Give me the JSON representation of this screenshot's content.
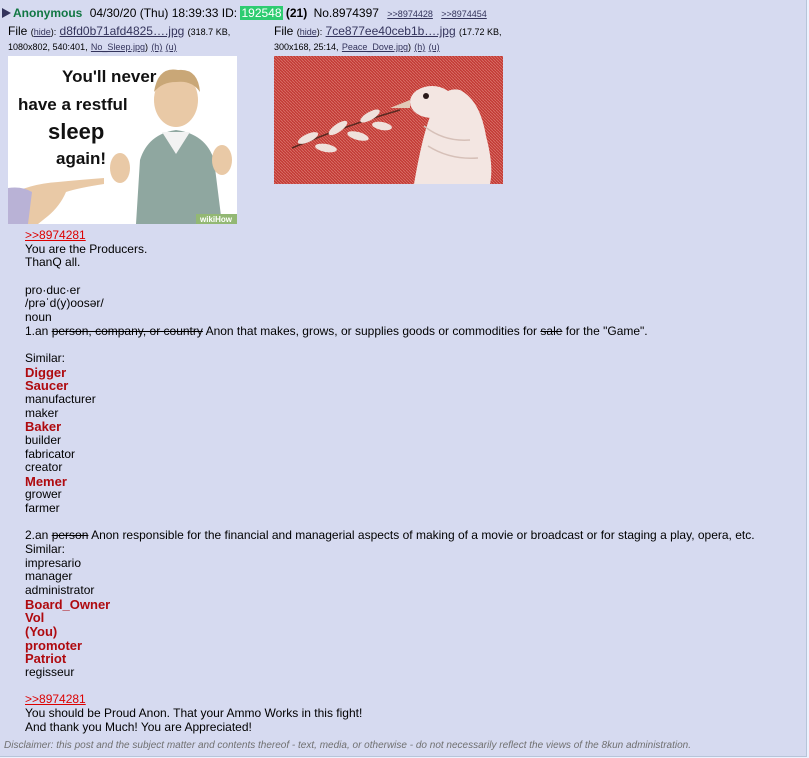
{
  "post": {
    "name": "Anonymous",
    "date": "04/30/20 (Thu) 18:39:33",
    "id_label": "ID:",
    "id": "192548",
    "id_count": "(21)",
    "no": "No.8974397",
    "backlinks": [
      ">>8974428",
      ">>8974454"
    ]
  },
  "files": [
    {
      "file_label": "File",
      "hide": "hide",
      "name": "d8fd0b71afd4825….jpg",
      "size_a": "(318.7 KB,",
      "size_b": "1080x802, 540:401,",
      "orig": "No_Sleep.jpg",
      "h": "(h)",
      "u": "(u)",
      "caption": "You'll never have a restful sleep again!",
      "watermark": "wikiHow"
    },
    {
      "file_label": "File",
      "hide": "hide",
      "name": "7ce877ee40ceb1b….jpg",
      "size_a": "(17.72 KB,",
      "size_b": "300x168, 25:14,",
      "orig": "Peace_Dove.jpg",
      "h": "(h)",
      "u": "(u)"
    }
  ],
  "body": {
    "quote1": ">>8974281",
    "l1": "You are the Producers.",
    "l2": "ThanQ all.",
    "l3": "pro·duc·er",
    "l4": "/prəˈd(y)oosər/",
    "l5": "noun",
    "def1_a": "1.an ",
    "def1_strike": "person, company, or country",
    "def1_b": " Anon that makes, grows, or supplies goods or commodities for ",
    "def1_strike2": "sale",
    "def1_c": " for the \"Game\".",
    "similar1": "Similar:",
    "digger": "Digger",
    "saucer": "Saucer",
    "manufacturer": "manufacturer",
    "maker": "maker",
    "baker": "Baker",
    "builder": "builder",
    "fabricator": "fabricator",
    "creator": "creator",
    "memer": "Memer",
    "grower": "grower",
    "farmer": "farmer",
    "def2_a": "2.an ",
    "def2_strike": "person",
    "def2_b": " Anon responsible for the financial and managerial aspects of making of a movie or broadcast or for staging a play, opera, etc.",
    "similar2": "Similar:",
    "impresario": "impresario",
    "manager": "manager",
    "administrator": "administrator",
    "board_owner": "Board_Owner",
    "vol": "Vol",
    "you": "(You)",
    "promoter": "promoter",
    "patriot": "Patriot",
    "regisseur": "regisseur",
    "quote2": ">>8974281",
    "l_last1": "You should be Proud Anon. That your Ammo Works in this fight!",
    "l_last2": "And thank you Much! You are Appreciated!"
  },
  "disclaimer": "Disclaimer: this post and the subject matter and contents thereof - text, media, or otherwise - do not necessarily reflect the views of the 8kun administration."
}
